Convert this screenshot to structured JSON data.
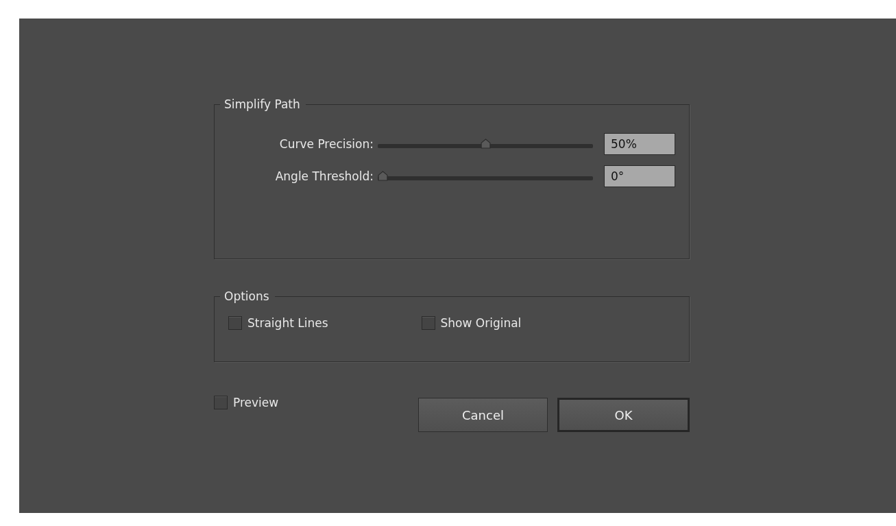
{
  "sections": [
    {
      "title": "Simplify Path",
      "kind": "sliders",
      "sliders": [
        {
          "label": "Curve Precision:",
          "level": 0.5,
          "value": "50%"
        },
        {
          "label": "Angle Threshold:",
          "level": 0.0,
          "value": "0°"
        }
      ]
    },
    {
      "title": "Options",
      "kind": "checkboxes",
      "checkboxes": [
        {
          "label": "Straight Lines",
          "checked": false
        },
        {
          "label": "Show Original",
          "checked": false
        }
      ]
    }
  ],
  "preview": {
    "label": "Preview",
    "checked": false
  },
  "buttons": [
    {
      "label": "Cancel",
      "default": false
    },
    {
      "label": "OK",
      "default": true
    }
  ]
}
